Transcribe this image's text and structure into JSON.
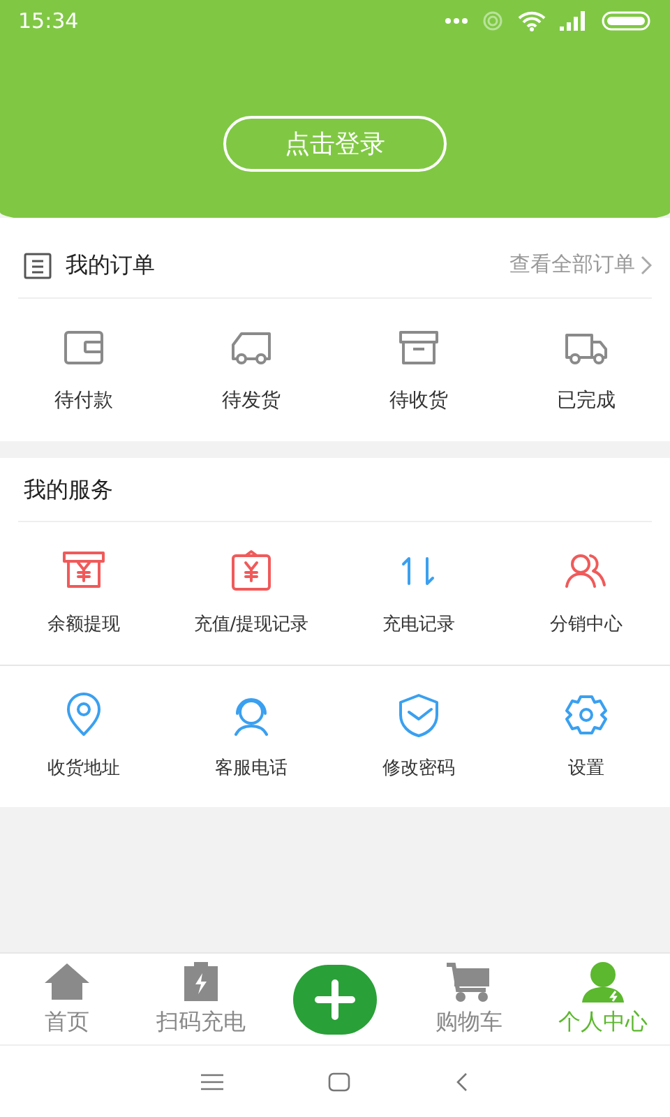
{
  "status_bar": {
    "time": "15:34"
  },
  "header": {
    "login_button": "点击登录"
  },
  "orders": {
    "title": "我的订单",
    "view_all": "查看全部订单",
    "items": [
      {
        "kind": "wallet",
        "label": "待付款"
      },
      {
        "kind": "van",
        "label": "待发货"
      },
      {
        "kind": "box",
        "label": "待收货"
      },
      {
        "kind": "truck",
        "label": "已完成"
      }
    ]
  },
  "services": {
    "title": "我的服务",
    "rows": [
      [
        {
          "kind": "withdraw",
          "color": "#f05a5a",
          "label": "余额提现"
        },
        {
          "kind": "clipboard",
          "color": "#f05a5a",
          "label": "充值/提现记录"
        },
        {
          "kind": "arrows",
          "color": "#3aa0f0",
          "label": "充电记录"
        },
        {
          "kind": "people",
          "color": "#f05a5a",
          "label": "分销中心"
        }
      ],
      [
        {
          "kind": "pin",
          "color": "#3aa0f0",
          "label": "收货地址"
        },
        {
          "kind": "headset",
          "color": "#3aa0f0",
          "label": "客服电话"
        },
        {
          "kind": "shield",
          "color": "#3aa0f0",
          "label": "修改密码"
        },
        {
          "kind": "gear",
          "color": "#3aa0f0",
          "label": "设置"
        }
      ]
    ]
  },
  "tab_bar": [
    {
      "kind": "home",
      "label": "首页",
      "selected": false
    },
    {
      "kind": "charge",
      "label": "扫码充电",
      "selected": false
    },
    {
      "kind": "plus"
    },
    {
      "kind": "cart",
      "label": "购物车",
      "selected": false
    },
    {
      "kind": "user",
      "label": "个人中心",
      "selected": true
    }
  ]
}
